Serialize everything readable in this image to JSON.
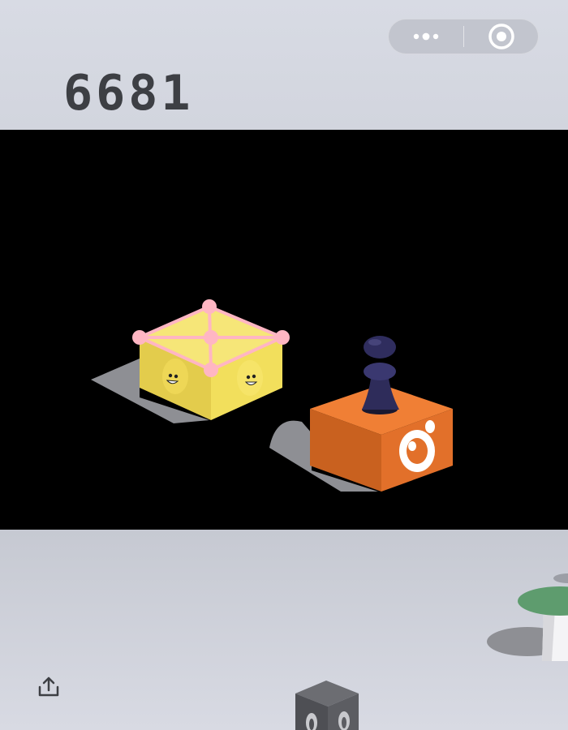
{
  "game": {
    "score": "6681"
  },
  "capsule": {
    "more_icon": "more-dots-icon",
    "close_icon": "target-close-icon"
  },
  "share_icon": "share-upload-icon",
  "colors": {
    "background": "#d4d7e0",
    "stage": "#000000",
    "score_text": "#3d3f44",
    "yellow_block": "#f4e36a",
    "pink_outline": "#ffb3c1",
    "orange_block": "#e8762d",
    "player": "#2c2b55",
    "mushroom_cap": "#5e9c6e",
    "grey_block": "#5a5b60"
  }
}
